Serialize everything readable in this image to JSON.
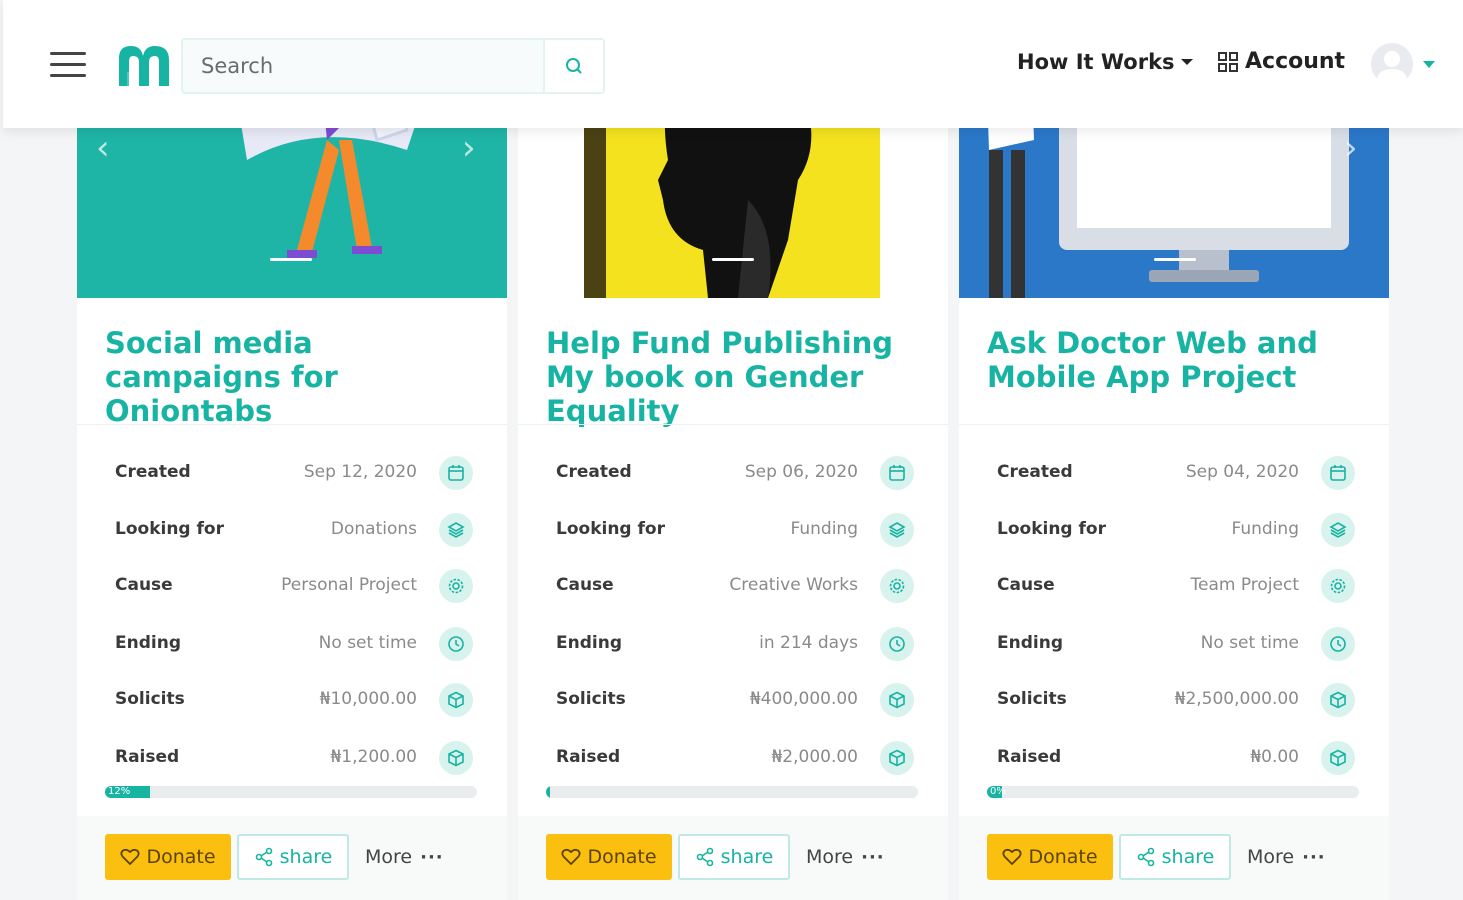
{
  "header": {
    "search_placeholder": "Search",
    "nav_how": "How It Works",
    "nav_account": "Account"
  },
  "colors": {
    "accent": "#17b3a3",
    "donate": "#fbbf0f"
  },
  "cards": [
    {
      "title": "Social media campaigns for Oniontabs",
      "rows": [
        {
          "label": "Created",
          "value": "Sep 12, 2020",
          "icon": "calendar-icon"
        },
        {
          "label": "Looking for",
          "value": "Donations",
          "icon": "layers-icon"
        },
        {
          "label": "Cause",
          "value": "Personal Project",
          "icon": "gear-icon"
        },
        {
          "label": "Ending",
          "value": "No set time",
          "icon": "clock-icon"
        },
        {
          "label": "Solicits",
          "value": "₦10,000.00",
          "icon": "box-icon"
        },
        {
          "label": "Raised",
          "value": "₦1,200.00",
          "icon": "box-icon"
        }
      ],
      "progress_label": "12%",
      "progress": 0.12,
      "donate": "Donate",
      "share": "share",
      "more": "More"
    },
    {
      "title": "Help Fund Publishing My book on Gender Equality",
      "rows": [
        {
          "label": "Created",
          "value": "Sep 06, 2020",
          "icon": "calendar-icon"
        },
        {
          "label": "Looking for",
          "value": "Funding",
          "icon": "layers-icon"
        },
        {
          "label": "Cause",
          "value": "Creative Works",
          "icon": "gear-icon"
        },
        {
          "label": "Ending",
          "value": "in 214 days",
          "icon": "clock-icon"
        },
        {
          "label": "Solicits",
          "value": "₦400,000.00",
          "icon": "box-icon"
        },
        {
          "label": "Raised",
          "value": "₦2,000.00",
          "icon": "box-icon"
        }
      ],
      "progress_label": "",
      "progress": 0.005,
      "donate": "Donate",
      "share": "share",
      "more": "More"
    },
    {
      "title": "Ask Doctor Web and Mobile App Project",
      "rows": [
        {
          "label": "Created",
          "value": "Sep 04, 2020",
          "icon": "calendar-icon"
        },
        {
          "label": "Looking for",
          "value": "Funding",
          "icon": "layers-icon"
        },
        {
          "label": "Cause",
          "value": "Team Project",
          "icon": "gear-icon"
        },
        {
          "label": "Ending",
          "value": "No set time",
          "icon": "clock-icon"
        },
        {
          "label": "Solicits",
          "value": "₦2,500,000.00",
          "icon": "box-icon"
        },
        {
          "label": "Raised",
          "value": "₦0.00",
          "icon": "box-icon"
        }
      ],
      "progress_label": "0%",
      "progress": 0.0,
      "donate": "Donate",
      "share": "share",
      "more": "More"
    }
  ]
}
